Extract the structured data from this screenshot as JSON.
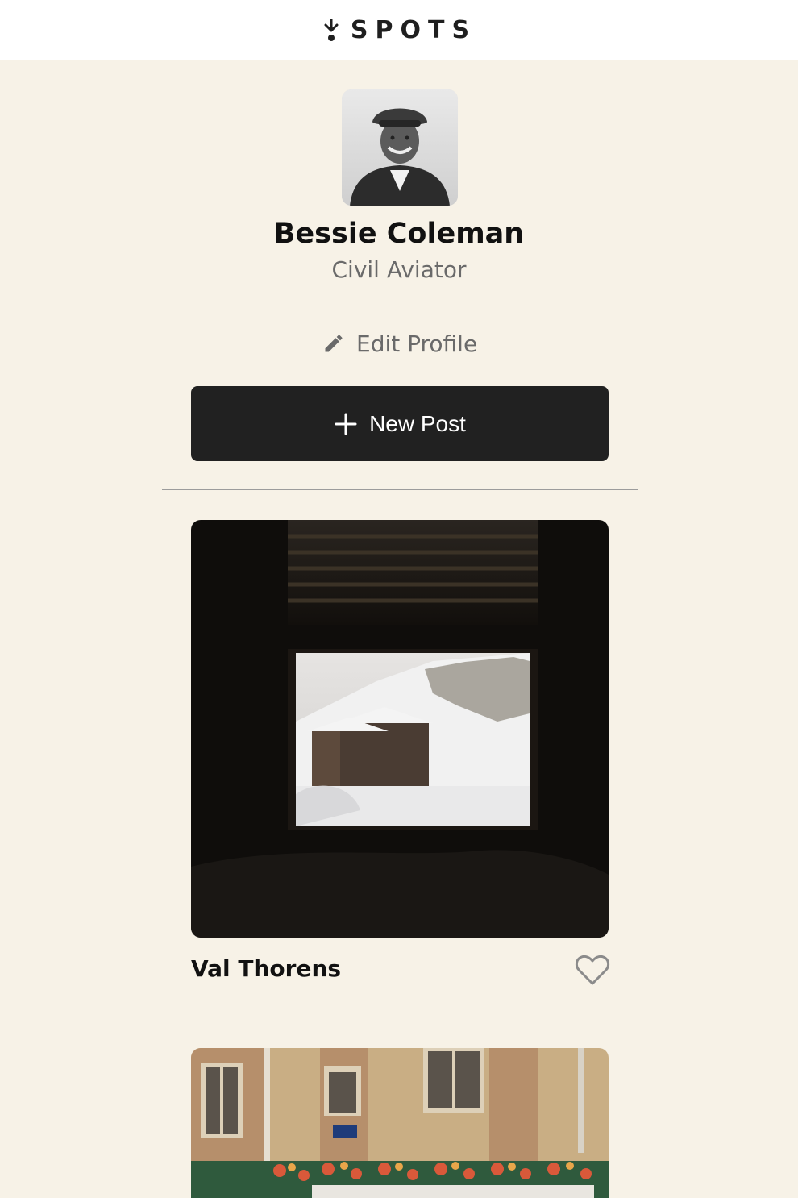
{
  "app": {
    "logo_text": "SPOTS",
    "logo_icon": "spots-mark-icon"
  },
  "profile": {
    "name": "Bessie Coleman",
    "title": "Civil Aviator",
    "avatar_icon": "profile-photo",
    "edit_label": "Edit Profile",
    "edit_icon": "pencil-icon"
  },
  "actions": {
    "new_post_label": "New Post",
    "new_post_icon": "plus-icon"
  },
  "cards": [
    {
      "title": "Val Thorens",
      "liked": false,
      "like_icon": "heart-icon"
    },
    {
      "title": ""
    }
  ],
  "colors": {
    "page_background": "#f7f2e7",
    "header_background": "#ffffff",
    "button_dark": "#212121",
    "muted_text": "#6a6a6a"
  }
}
